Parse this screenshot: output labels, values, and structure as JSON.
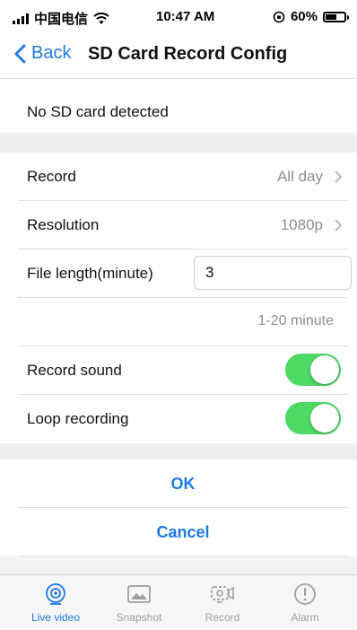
{
  "status_bar": {
    "carrier": "中国电信",
    "time": "10:47 AM",
    "battery_pct": "60%",
    "battery_level": 0.6
  },
  "nav": {
    "back_label": "Back",
    "title": "SD Card Record Config"
  },
  "sd_status": "No SD card detected",
  "settings": {
    "record": {
      "label": "Record",
      "value": "All day"
    },
    "resolution": {
      "label": "Resolution",
      "value": "1080p"
    },
    "file_length": {
      "label": "File length(minute)",
      "value": "3",
      "hint": "1-20 minute"
    },
    "record_sound": {
      "label": "Record sound",
      "on": true
    },
    "loop_recording": {
      "label": "Loop recording",
      "on": true
    }
  },
  "actions": {
    "ok": "OK",
    "cancel": "Cancel"
  },
  "tabs": [
    {
      "label": "Live video",
      "icon": "live-video-icon",
      "active": true
    },
    {
      "label": "Snapshot",
      "icon": "snapshot-icon",
      "active": false
    },
    {
      "label": "Record",
      "icon": "record-icon",
      "active": false
    },
    {
      "label": "Alarm",
      "icon": "alarm-icon",
      "active": false
    }
  ],
  "colors": {
    "accent": "#1e7ae6",
    "toggle_on": "#4cd964",
    "separator_bg": "#eeeeee"
  }
}
